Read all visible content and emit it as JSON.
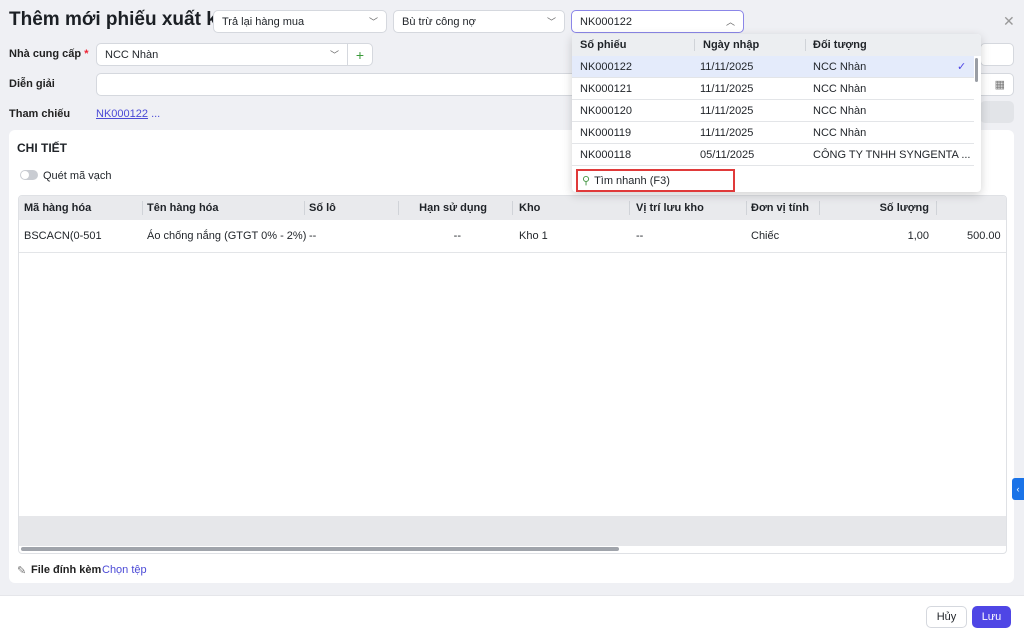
{
  "header": {
    "title": "Thêm mới phiếu xuất kho",
    "type_select": "Trả lại hàng mua",
    "payment_select": "Bù trừ công nợ",
    "ref_select": "NK000122"
  },
  "form": {
    "supplier_label": "Nhà cung cấp",
    "required_mark": "*",
    "supplier_value": "NCC Nhàn",
    "description_label": "Diễn giải",
    "description_value": "",
    "reference_label": "Tham chiếu",
    "reference_link": "NK000122",
    "reference_more": "..."
  },
  "detail": {
    "section_title": "CHI TIẾT",
    "barcode_toggle": "Quét mã vạch",
    "barcode_on": false,
    "columns": [
      "Mã hàng hóa",
      "Tên hàng hóa",
      "Số lô",
      "Hạn sử dụng",
      "Kho",
      "Vị trí lưu kho",
      "Đơn vị tính",
      "Số lượng"
    ],
    "rows": [
      [
        "BSCACN(0-501",
        "Áo chống nắng (GTGT 0% - 2%)",
        "--",
        "--",
        "Kho 1",
        "--",
        "Chiếc",
        "1,00",
        "500.00"
      ]
    ]
  },
  "attachment": {
    "label": "File đính kèm",
    "choose": "Chọn tệp"
  },
  "footer": {
    "cancel": "Hủy",
    "save": "Lưu"
  },
  "dropdown": {
    "columns": [
      "Số phiếu",
      "Ngày nhập",
      "Đối tượng"
    ],
    "rows": [
      [
        "NK000122",
        "11/11/2025",
        "NCC Nhàn"
      ],
      [
        "NK000121",
        "11/11/2025",
        "NCC Nhàn"
      ],
      [
        "NK000120",
        "11/11/2025",
        "NCC Nhàn"
      ],
      [
        "NK000119",
        "11/11/2025",
        "NCC Nhàn"
      ],
      [
        "NK000118",
        "05/11/2025",
        "CÔNG TY TNHH SYNGENTA ..."
      ]
    ],
    "selected_index": 0,
    "search_placeholder": "Tìm nhanh (F3)"
  },
  "colors": {
    "accent": "#4f46e5",
    "selected_row": "#e4ebfb",
    "highlight_box": "#e03a3a"
  }
}
